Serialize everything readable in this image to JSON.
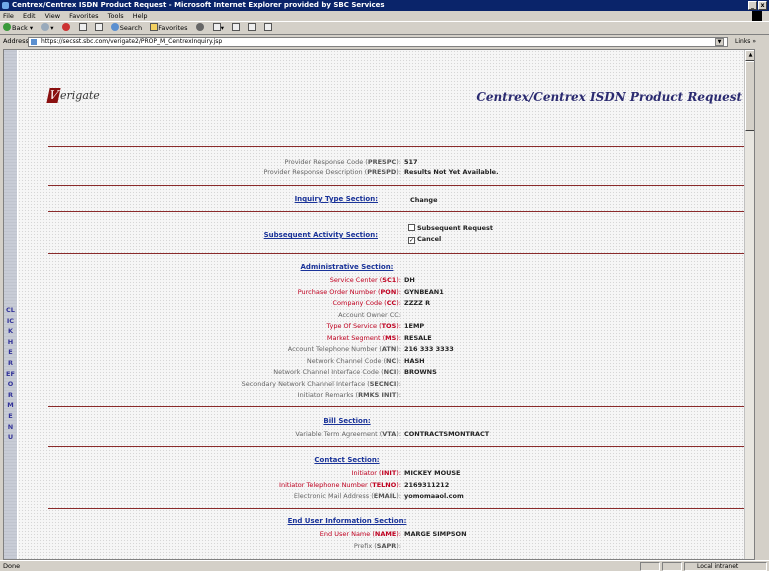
{
  "window": {
    "title": "Centrex/Centrex ISDN Product Request - Microsoft Internet Explorer provided by SBC Services"
  },
  "menu": [
    "File",
    "Edit",
    "View",
    "Favorites",
    "Tools",
    "Help"
  ],
  "toolbar": {
    "back": "Back",
    "search": "Search",
    "favorites": "Favorites"
  },
  "address": {
    "label": "Address",
    "url": "https://secsst.sbc.com/verigate2/PROP_M_CentrexInquiry.jsp",
    "links": "Links"
  },
  "sidebar": {
    "text": "CLICKHEREFORMENU"
  },
  "header": {
    "logo_text": "erigate",
    "logo_letter": "V",
    "title": "Centrex/Centrex ISDN Product Request"
  },
  "response": {
    "prespc_label_pre": "Provider Response Code (",
    "prespc_label_code": "PRESPC",
    "prespc_label_post": "):",
    "prespc_value": "517",
    "prespd_label_pre": "Provider Response Description (",
    "prespd_label_code": "PRESPD",
    "prespd_label_post": "):",
    "prespd_value": "Results Not Yet Available."
  },
  "inquiry": {
    "title": "Inquiry Type Section:",
    "value": "Change"
  },
  "subsequent": {
    "title": "Subsequent Activity Section:",
    "option1": "Subsequent Request",
    "option1_checked": false,
    "option2": "Cancel",
    "option2_checked": true
  },
  "admin": {
    "title": "Administrative Section:",
    "rows": [
      {
        "label": "Service Center (",
        "code": "SC1",
        "post": "):",
        "value": "DH",
        "required": true
      },
      {
        "label": "Purchase Order Number (",
        "code": "PON",
        "post": "):",
        "value": "GYNBEAN1",
        "required": true
      },
      {
        "label": "Company Code (",
        "code": "CC",
        "post": "):",
        "value": "ZZZZ R",
        "required": true
      },
      {
        "label": "Account Owner CC:",
        "code": "",
        "post": "",
        "value": "",
        "required": false
      },
      {
        "label": "Type Of Service (",
        "code": "TOS",
        "post": "):",
        "value": "1EMP",
        "required": true
      },
      {
        "label": "Market Segment (",
        "code": "MS",
        "post": "):",
        "value": "RESALE",
        "required": true
      },
      {
        "label": "Account Telephone Number (",
        "code": "ATN",
        "post": "):",
        "value": "216   333   3333",
        "required": false
      },
      {
        "label": "Network Channel Code (",
        "code": "NC",
        "post": "):",
        "value": "HASH",
        "required": false
      },
      {
        "label": "Network Channel Interface Code (",
        "code": "NCI",
        "post": "):",
        "value": "BROWNS",
        "required": false
      },
      {
        "label": "Secondary Network Channel Interface (",
        "code": "SECNCI",
        "post": "):",
        "value": "",
        "required": false
      },
      {
        "label": "Initiator Remarks (",
        "code": "RMKS INIT",
        "post": "):",
        "value": "",
        "required": false
      }
    ]
  },
  "bill": {
    "title": "Bill Section:",
    "vta_label": "Variable Term Agreement (",
    "vta_code": "VTA",
    "vta_post": "):",
    "vta_value": "CONTRACTSMONTRACT"
  },
  "contact": {
    "title": "Contact Section:",
    "rows": [
      {
        "label": "Initiator (",
        "code": "INIT",
        "post": "):",
        "value": "MICKEY MOUSE",
        "required": true
      },
      {
        "label": "Initiator Telephone Number (",
        "code": "TELNO",
        "post": "):",
        "value": "2169311212",
        "required": true
      },
      {
        "label": "Electronic Mail Address (",
        "code": "EMAIL",
        "post": "):",
        "value": "yomomaaol.com",
        "required": false
      }
    ]
  },
  "enduser": {
    "title": "End User Information Section:",
    "rows": [
      {
        "label": "End User Name (",
        "code": "NAME",
        "post": "):",
        "value": "MARGE SIMPSON",
        "required": true
      },
      {
        "label": "Prefix (",
        "code": "SAPR",
        "post": "):",
        "value": "",
        "required": false
      }
    ]
  },
  "status": {
    "text": "Done",
    "zone": "Local intranet"
  }
}
